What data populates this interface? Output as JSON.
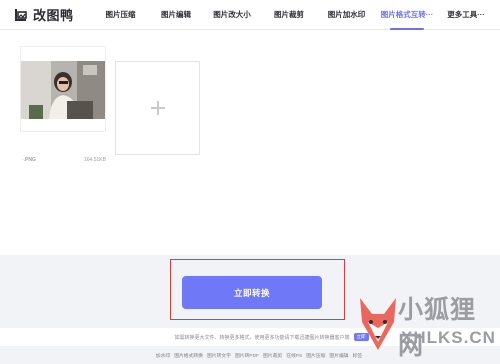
{
  "app": {
    "logo_text": "改图鸭"
  },
  "nav": {
    "items": [
      {
        "label": "图片压缩"
      },
      {
        "label": "图片编辑"
      },
      {
        "label": "图片改大小"
      },
      {
        "label": "图片裁剪"
      },
      {
        "label": "图片加水印"
      },
      {
        "label": "图片格式互转···"
      },
      {
        "label": "更多工具···"
      }
    ],
    "active_index": 5
  },
  "file": {
    "name": "·.PNG",
    "size": "164.51KB"
  },
  "convert": {
    "button_label": "立即转换"
  },
  "tip": {
    "text": "· 如需转换更大文件、转换更多格式，使用更多功能请下载迅捷图片转换器客户端",
    "badge": "立即"
  },
  "footer": {
    "links": [
      "加水印",
      "图片格式转换",
      "图片转文字",
      "图片转PDF",
      "图片裁剪",
      "在线PS",
      "图片压缩",
      "图片编辑",
      "标签"
    ]
  },
  "watermark": {
    "cn_text": "小狐狸网",
    "en_text": "XHLKS.CN"
  },
  "colors": {
    "accent": "#6f78f7",
    "highlight": "#e53a3a",
    "nav_active": "#6b72f5"
  }
}
